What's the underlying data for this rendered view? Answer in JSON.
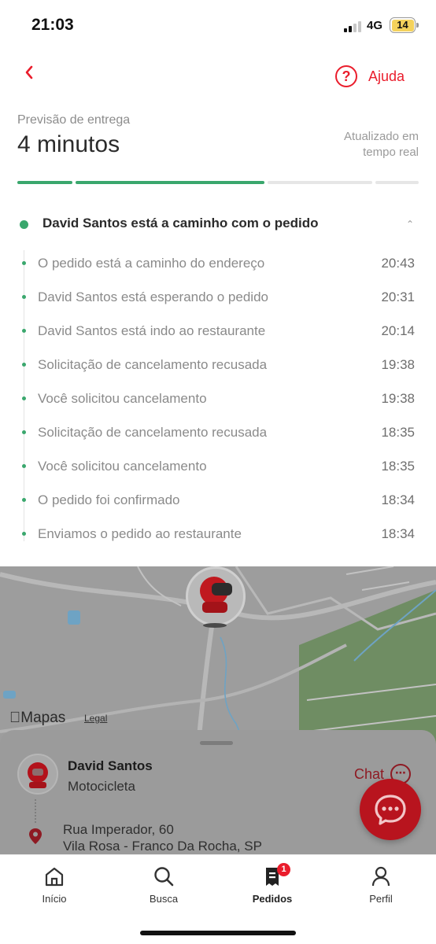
{
  "status_bar": {
    "time": "21:03",
    "network": "4G",
    "battery": "14"
  },
  "header": {
    "help_label": "Ajuda"
  },
  "delivery": {
    "eta_label": "Previsão de entrega",
    "eta_value": "4 minutos",
    "updated_label": "Atualizado em tempo real",
    "progress_segments": [
      1,
      1,
      0,
      0
    ]
  },
  "timeline": {
    "current": "David Santos está a caminho com o pedido",
    "steps": [
      {
        "text": "O pedido está a caminho do endereço",
        "time": "20:43"
      },
      {
        "text": "David Santos está esperando o pedido",
        "time": "20:31"
      },
      {
        "text": "David Santos está indo ao restaurante",
        "time": "20:14"
      },
      {
        "text": "Solicitação de cancelamento recusada",
        "time": "19:38"
      },
      {
        "text": "Você solicitou cancelamento",
        "time": "19:38"
      },
      {
        "text": "Solicitação de cancelamento recusada",
        "time": "18:35"
      },
      {
        "text": "Você solicitou cancelamento",
        "time": "18:35"
      },
      {
        "text": "O pedido foi confirmado",
        "time": "18:34"
      },
      {
        "text": "Enviamos o pedido ao restaurante",
        "time": "18:34"
      }
    ]
  },
  "map": {
    "attribution": "Mapas",
    "legal": "Legal"
  },
  "courier": {
    "name": "David Santos",
    "vehicle": "Motocicleta",
    "chat_label": "Chat",
    "address_line1": "Rua Imperador, 60",
    "address_line2": "Vila Rosa - Franco Da Rocha, SP"
  },
  "tabbar": {
    "tabs": [
      {
        "label": "Início",
        "icon": "home-icon"
      },
      {
        "label": "Busca",
        "icon": "search-icon"
      },
      {
        "label": "Pedidos",
        "icon": "orders-icon",
        "badge": "1"
      },
      {
        "label": "Perfil",
        "icon": "profile-icon"
      }
    ]
  },
  "colors": {
    "accent": "#ea1d2c",
    "success": "#3aa76d"
  }
}
